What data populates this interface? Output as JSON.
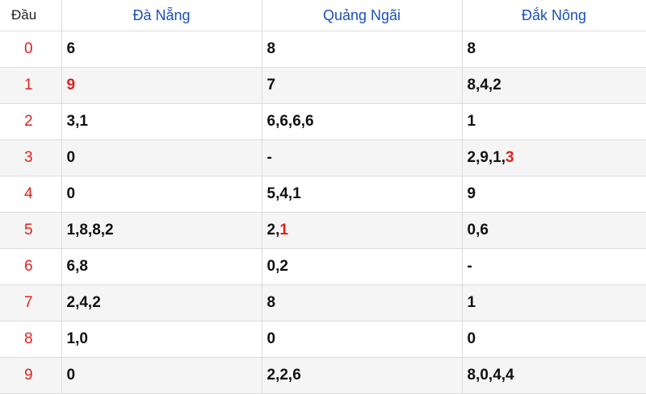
{
  "table": {
    "header": {
      "head_label": "Đầu",
      "provinces": [
        "Đà Nẵng",
        "Quảng Ngãi",
        "Đắk Nông"
      ]
    },
    "rows": [
      {
        "head": "0",
        "cells": [
          {
            "text": "6",
            "hl": ""
          },
          {
            "text": "8",
            "hl": ""
          },
          {
            "text": "8",
            "hl": ""
          }
        ]
      },
      {
        "head": "1",
        "cells": [
          {
            "text": "",
            "hl": "9"
          },
          {
            "text": "7",
            "hl": ""
          },
          {
            "text": "8,4,2",
            "hl": ""
          }
        ]
      },
      {
        "head": "2",
        "cells": [
          {
            "text": "3,1",
            "hl": ""
          },
          {
            "text": "6,6,6,6",
            "hl": ""
          },
          {
            "text": "1",
            "hl": ""
          }
        ]
      },
      {
        "head": "3",
        "cells": [
          {
            "text": "0",
            "hl": ""
          },
          {
            "text": "-",
            "hl": ""
          },
          {
            "text": "2,9,1,",
            "hl": "3"
          }
        ]
      },
      {
        "head": "4",
        "cells": [
          {
            "text": "0",
            "hl": ""
          },
          {
            "text": "5,4,1",
            "hl": ""
          },
          {
            "text": "9",
            "hl": ""
          }
        ]
      },
      {
        "head": "5",
        "cells": [
          {
            "text": "1,8,8,2",
            "hl": ""
          },
          {
            "text": "2,",
            "hl": "1"
          },
          {
            "text": "0,6",
            "hl": ""
          }
        ]
      },
      {
        "head": "6",
        "cells": [
          {
            "text": "6,8",
            "hl": ""
          },
          {
            "text": "0,2",
            "hl": ""
          },
          {
            "text": "-",
            "hl": ""
          }
        ]
      },
      {
        "head": "7",
        "cells": [
          {
            "text": "2,4,2",
            "hl": ""
          },
          {
            "text": "8",
            "hl": ""
          },
          {
            "text": "1",
            "hl": ""
          }
        ]
      },
      {
        "head": "8",
        "cells": [
          {
            "text": "1,0",
            "hl": ""
          },
          {
            "text": "0",
            "hl": ""
          },
          {
            "text": "0",
            "hl": ""
          }
        ]
      },
      {
        "head": "9",
        "cells": [
          {
            "text": "0",
            "hl": ""
          },
          {
            "text": "2,2,6",
            "hl": ""
          },
          {
            "text": "8,0,4,4",
            "hl": ""
          }
        ]
      }
    ]
  },
  "colors": {
    "header_text": "#1a4fb8",
    "head_number": "#e02020",
    "highlight": "#e0201e",
    "row_alt_bg": "#f5f5f5",
    "border": "#dcdcdc"
  }
}
